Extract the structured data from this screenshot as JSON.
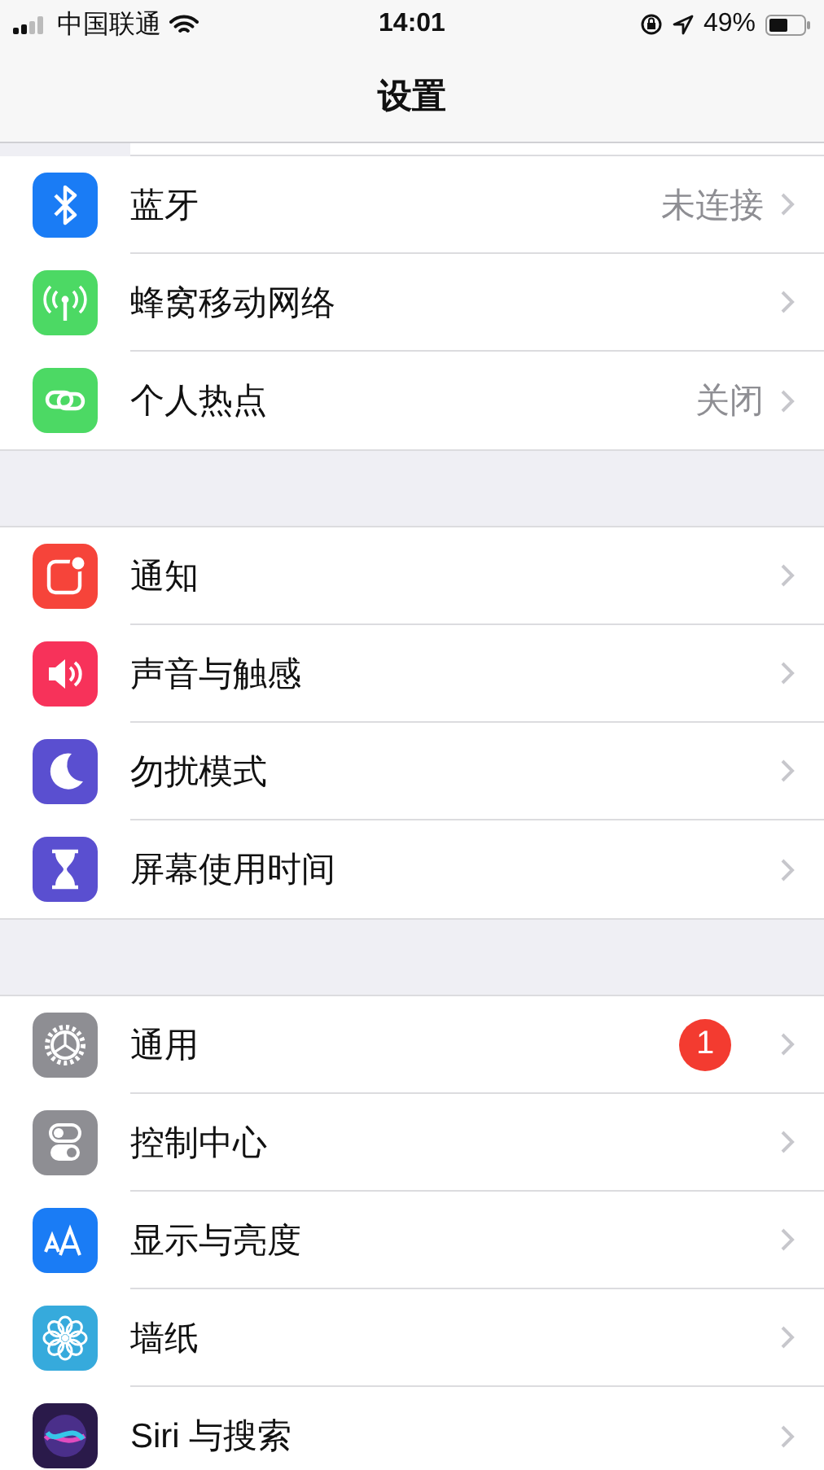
{
  "status_bar": {
    "carrier": "中国联通",
    "time": "14:01",
    "battery": "49%"
  },
  "nav": {
    "title": "设置"
  },
  "groups": [
    {
      "rows": [
        {
          "kind": "bluetooth",
          "color": "#1a7cf5",
          "label": "蓝牙",
          "value": "未连接"
        },
        {
          "kind": "antenna",
          "color": "#4cd964",
          "label": "蜂窝移动网络"
        },
        {
          "kind": "link",
          "color": "#4cd964",
          "label": "个人热点",
          "value": "关闭"
        }
      ]
    },
    {
      "rows": [
        {
          "kind": "notification",
          "color": "#f6443a",
          "label": "通知"
        },
        {
          "kind": "speaker",
          "color": "#f7325a",
          "label": "声音与触感"
        },
        {
          "kind": "moon",
          "color": "#5a4fd0",
          "label": "勿扰模式"
        },
        {
          "kind": "hourglass",
          "color": "#5a4fd0",
          "label": "屏幕使用时间"
        }
      ]
    },
    {
      "rows": [
        {
          "kind": "gear",
          "color": "#8e8e93",
          "label": "通用",
          "badge": "1"
        },
        {
          "kind": "toggles",
          "color": "#8e8e93",
          "label": "控制中心"
        },
        {
          "kind": "textsize",
          "color": "#1a7cf5",
          "label": "显示与亮度"
        },
        {
          "kind": "flower",
          "color": "#36aadc",
          "label": "墙纸"
        },
        {
          "kind": "orb",
          "color": "#2a1a4a",
          "label": "Siri 与搜索"
        }
      ]
    }
  ]
}
